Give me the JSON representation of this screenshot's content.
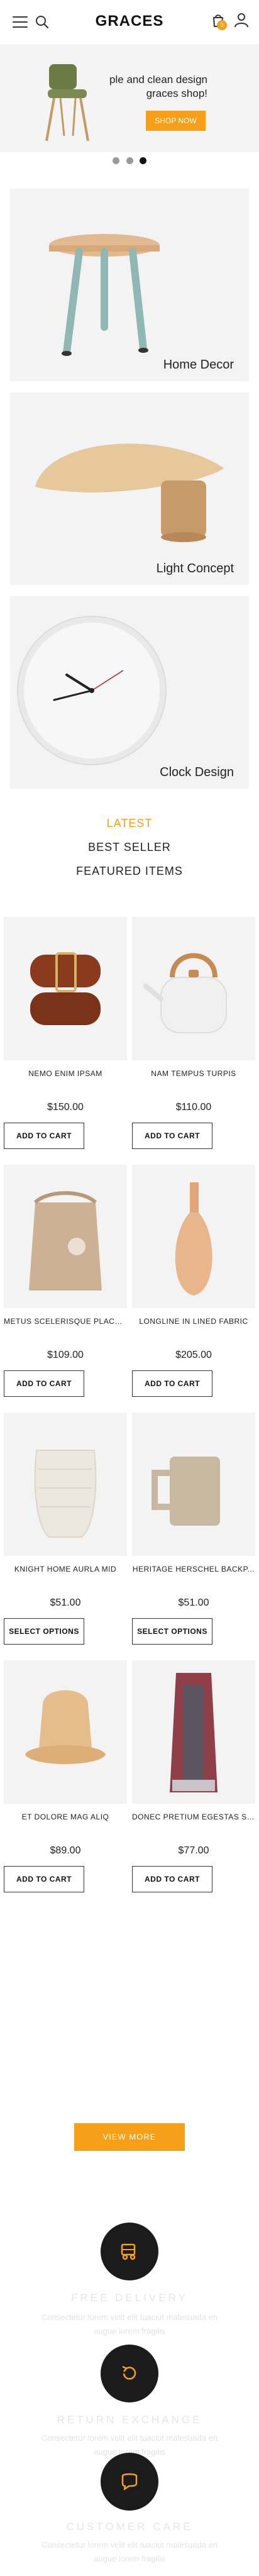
{
  "header": {
    "logo": "GRACES",
    "cart_count": "0"
  },
  "hero": {
    "title_line1": "ple and clean design",
    "title_line2": "graces shop!",
    "button": "SHOP NOW",
    "slides": 3,
    "active_slide": 3
  },
  "categories": [
    {
      "label": "Home Decor"
    },
    {
      "label": "Light Concept"
    },
    {
      "label": "Clock Design"
    }
  ],
  "tabs": [
    {
      "label": "LATEST",
      "active": true
    },
    {
      "label": "BEST SELLER",
      "active": false
    },
    {
      "label": "FEATURED ITEMS",
      "active": false
    }
  ],
  "products": [
    {
      "name": "NEMO ENIM IPSAM",
      "price": "$150.00",
      "button": "ADD TO CART"
    },
    {
      "name": "NAM TEMPUS TURPIS",
      "price": "$110.00",
      "button": "ADD TO CART"
    },
    {
      "name": "METUS SCELERISQUE PLACE...",
      "price": "$109.00",
      "button": "ADD TO CART"
    },
    {
      "name": "LONGLINE IN LINED FABRIC",
      "price": "$205.00",
      "button": "ADD TO CART"
    },
    {
      "name": "KNIGHT HOME AURLA MID",
      "price": "$51.00",
      "button": "SELECT OPTIONS"
    },
    {
      "name": "HERITAGE HERSCHEL BACKP...",
      "price": "$51.00",
      "button": "SELECT OPTIONS"
    },
    {
      "name": "ET DOLORE MAG ALIQ",
      "price": "$89.00",
      "button": "ADD TO CART"
    },
    {
      "name": "DONEC PRETIUM EGESTAS SA...",
      "price": "$77.00",
      "button": "ADD TO CART"
    }
  ],
  "view_more": "VIEW MORE",
  "features": [
    {
      "title": "FREE DELIVERY",
      "icon": "truck-icon",
      "desc": "Consectetur lorem velit elit tuaciut malesuada en augue lorem fragilis"
    },
    {
      "title": "RETURN EXCHANGE",
      "icon": "return-icon",
      "desc": "Consectetur lorem velit elit tuaciut malesuada en augue lorem fragilis"
    },
    {
      "title": "CUSTOMER CARE",
      "icon": "chat-icon",
      "desc": "Consectetur lorem velit elit tuaciut malesuada en augue lorem fragilis"
    }
  ],
  "colors": {
    "accent": "#f6a01a",
    "dark": "#1b1b1b"
  }
}
